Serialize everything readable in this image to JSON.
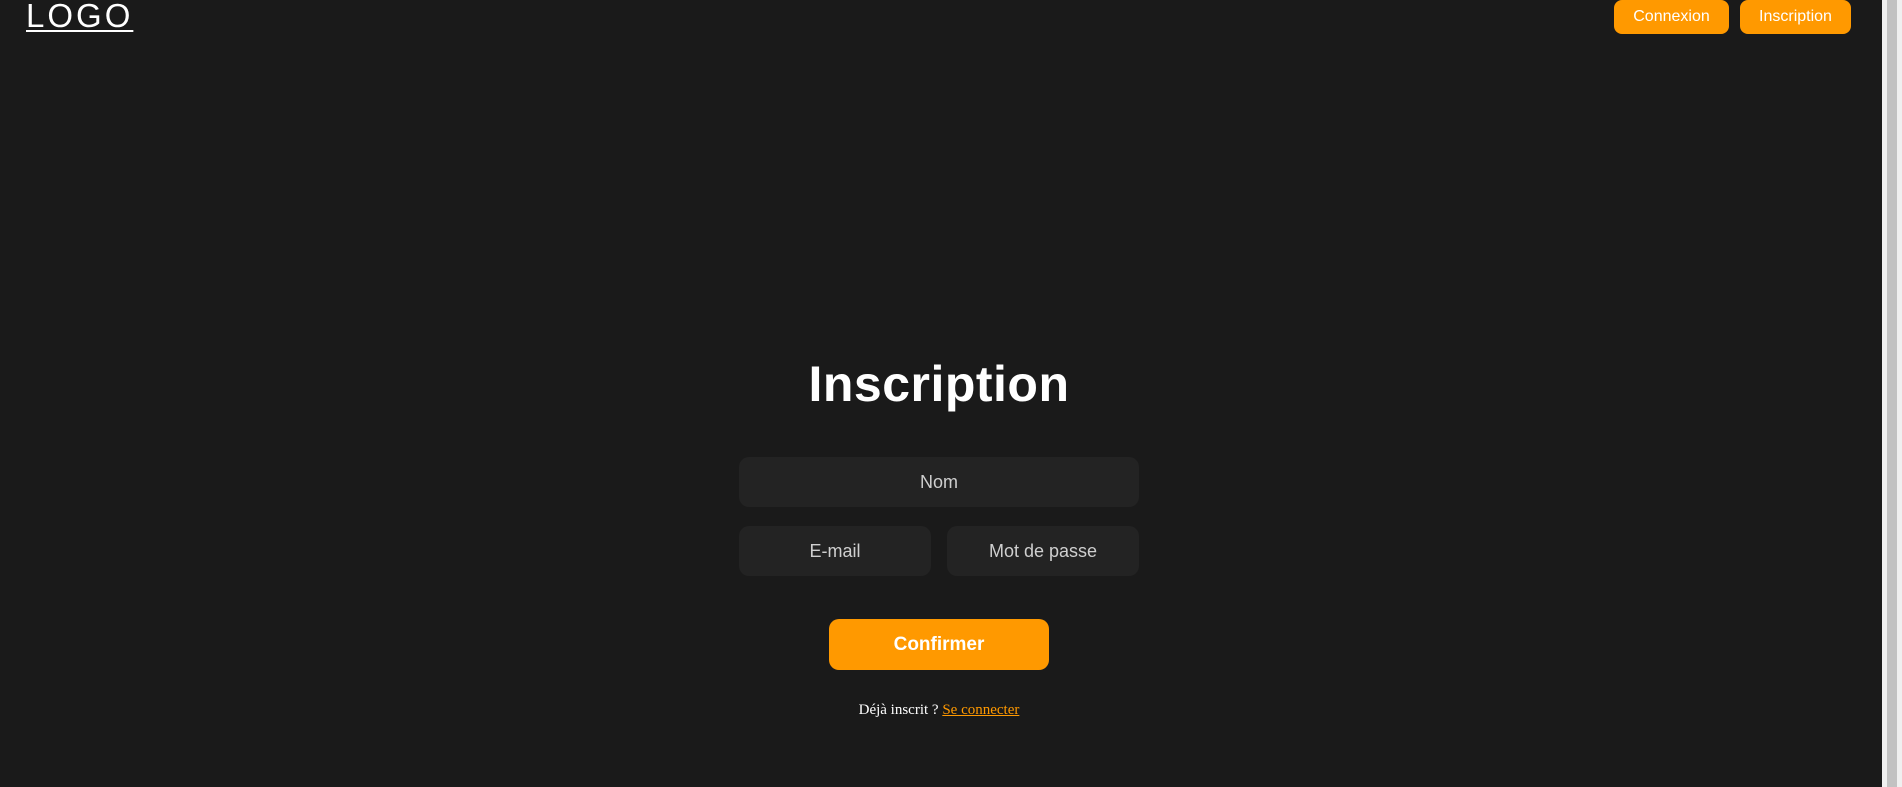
{
  "header": {
    "logo": "LOGO",
    "nav": {
      "login_label": "Connexion",
      "signup_label": "Inscription"
    }
  },
  "form": {
    "title": "Inscription",
    "fields": {
      "name_placeholder": "Nom",
      "email_placeholder": "E-mail",
      "password_placeholder": "Mot de passe"
    },
    "submit_label": "Confirmer",
    "footer": {
      "prompt": "Déjà inscrit ?",
      "link_label": "Se connecter"
    }
  },
  "colors": {
    "background": "#1a1a1a",
    "accent": "#ff9900",
    "field_background": "#232323"
  }
}
